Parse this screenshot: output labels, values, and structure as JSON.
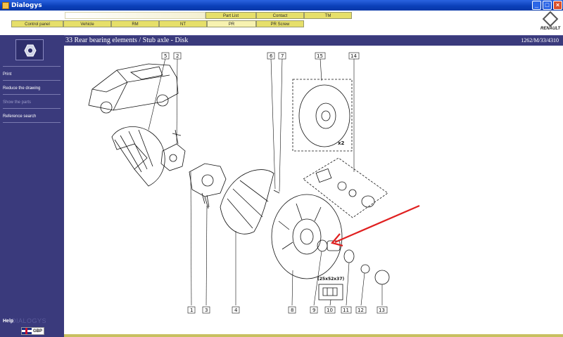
{
  "window": {
    "title": "Dialogys"
  },
  "tabs_row1": [
    "Part List",
    "Contact",
    "TM"
  ],
  "tabs_row2": [
    "Control panel",
    "Vehicle",
    "RM",
    "NT",
    "PR",
    "PR Screw"
  ],
  "active_tab": "PR",
  "brand": "RENAULT",
  "sidebar": {
    "menu": [
      "Print",
      "Reduce the drawing",
      "Show the parts",
      "Reference search"
    ],
    "disabled_item": "Show the parts",
    "help": "Help",
    "watermark": "DIALOGYS",
    "language": "GBP"
  },
  "header": {
    "title": "33 Rear bearing elements / Stub axle - Disk",
    "code": "1262/M/33/4310"
  },
  "diagram": {
    "callouts_top": [
      "5",
      "2",
      "6",
      "7",
      "15",
      "14"
    ],
    "callouts_bottom": [
      "1",
      "3",
      "4",
      "8",
      "9",
      "10",
      "11",
      "12",
      "13"
    ],
    "quantity": "x2",
    "dimension": "(25x52x37)"
  },
  "colors": {
    "accent": "#3a3a7c",
    "tab": "#e6df6a",
    "arrow": "#e02020"
  }
}
